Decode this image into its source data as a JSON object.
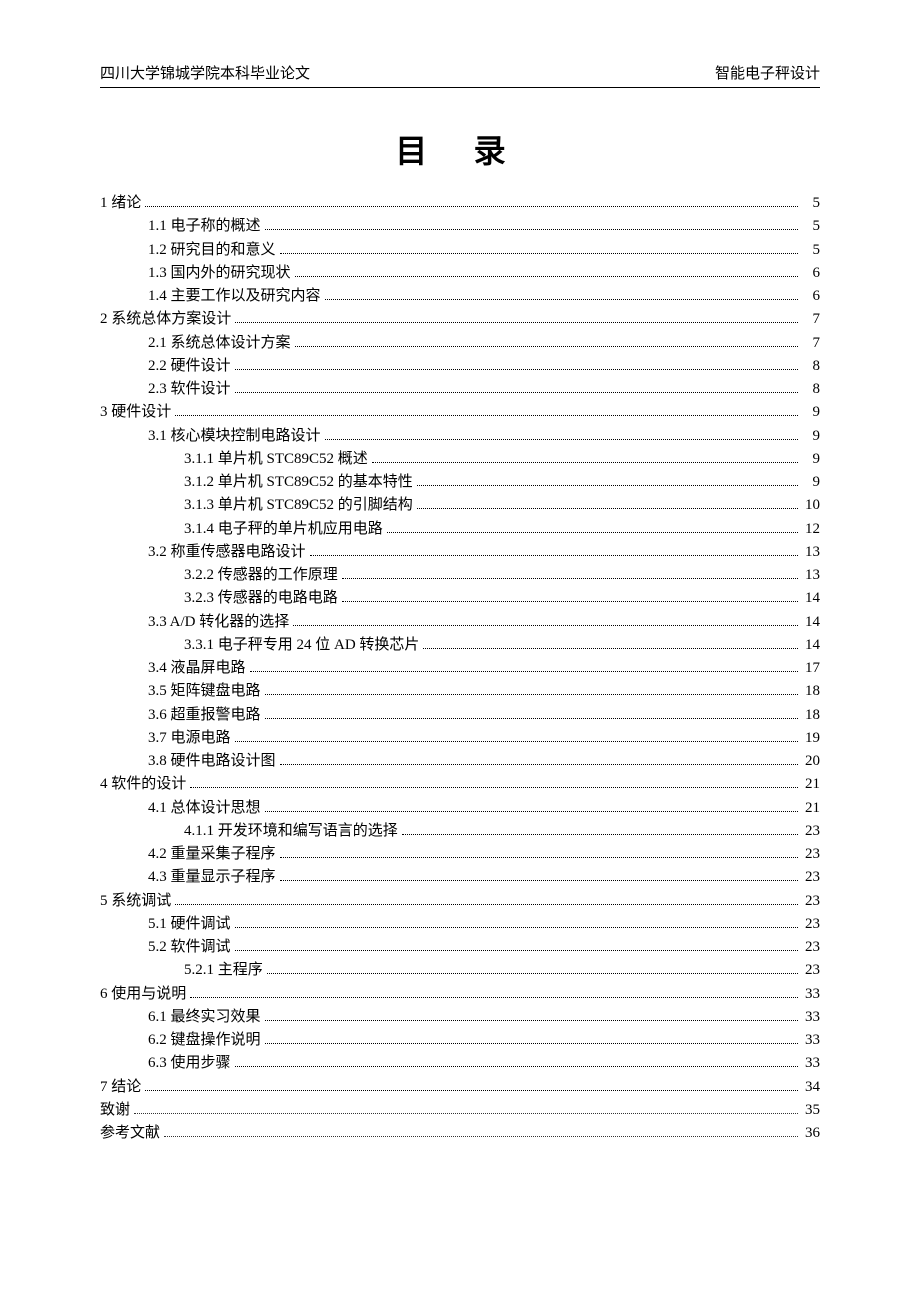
{
  "header": {
    "left": "四川大学锦城学院本科毕业论文",
    "right": "智能电子秤设计"
  },
  "title": "目 录",
  "toc": [
    {
      "level": 0,
      "label": "1 绪论",
      "page": "5"
    },
    {
      "level": 1,
      "label": "1.1 电子称的概述",
      "page": "5"
    },
    {
      "level": 1,
      "label": "1.2 研究目的和意义",
      "page": "5"
    },
    {
      "level": 1,
      "label": "1.3 国内外的研究现状",
      "page": "6"
    },
    {
      "level": 1,
      "label": "1.4 主要工作以及研究内容",
      "page": "6"
    },
    {
      "level": 0,
      "label": "2 系统总体方案设计",
      "page": "7"
    },
    {
      "level": 1,
      "label": "2.1 系统总体设计方案",
      "page": "7"
    },
    {
      "level": 1,
      "label": "2.2 硬件设计",
      "page": "8"
    },
    {
      "level": 1,
      "label": "2.3 软件设计",
      "page": "8"
    },
    {
      "level": 0,
      "label": "3 硬件设计",
      "page": "9"
    },
    {
      "level": 1,
      "label": "3.1 核心模块控制电路设计",
      "page": "9"
    },
    {
      "level": 2,
      "label": "3.1.1 单片机 STC89C52 概述",
      "page": "9"
    },
    {
      "level": 2,
      "label": "3.1.2 单片机 STC89C52 的基本特性",
      "page": "9"
    },
    {
      "level": 2,
      "label": "3.1.3 单片机 STC89C52 的引脚结构",
      "page": "10"
    },
    {
      "level": 2,
      "label": "3.1.4 电子秤的单片机应用电路",
      "page": "12"
    },
    {
      "level": 1,
      "label": "3.2 称重传感器电路设计",
      "page": "13"
    },
    {
      "level": 2,
      "label": "3.2.2 传感器的工作原理",
      "page": "13"
    },
    {
      "level": 2,
      "label": "3.2.3 传感器的电路电路",
      "page": "14"
    },
    {
      "level": 1,
      "label": "3.3 A/D 转化器的选择",
      "page": "14"
    },
    {
      "level": 2,
      "label": "3.3.1 电子秤专用 24 位 AD 转换芯片",
      "page": "14"
    },
    {
      "level": 1,
      "label": "3.4 液晶屏电路",
      "page": "17"
    },
    {
      "level": 1,
      "label": "3.5 矩阵键盘电路",
      "page": "18"
    },
    {
      "level": 1,
      "label": "3.6 超重报警电路",
      "page": "18"
    },
    {
      "level": 1,
      "label": "3.7 电源电路",
      "page": "19"
    },
    {
      "level": 1,
      "label": "3.8 硬件电路设计图",
      "page": "20"
    },
    {
      "level": 0,
      "label": "4 软件的设计",
      "page": "21"
    },
    {
      "level": 1,
      "label": "4.1 总体设计思想",
      "page": "21"
    },
    {
      "level": 2,
      "label": "4.1.1 开发环境和编写语言的选择",
      "page": "23"
    },
    {
      "level": 1,
      "label": "4.2 重量采集子程序",
      "page": "23"
    },
    {
      "level": 1,
      "label": "4.3 重量显示子程序",
      "page": "23"
    },
    {
      "level": 0,
      "label": "5 系统调试",
      "page": "23"
    },
    {
      "level": 1,
      "label": "5.1 硬件调试",
      "page": "23"
    },
    {
      "level": 1,
      "label": "5.2 软件调试",
      "page": "23"
    },
    {
      "level": 2,
      "label": "5.2.1 主程序",
      "page": "23"
    },
    {
      "level": 0,
      "label": "6 使用与说明",
      "page": "33"
    },
    {
      "level": 1,
      "label": "6.1 最终实习效果",
      "page": "33"
    },
    {
      "level": 1,
      "label": "6.2 键盘操作说明",
      "page": "33"
    },
    {
      "level": 1,
      "label": "6.3 使用步骤",
      "page": "33"
    },
    {
      "level": 0,
      "label": "7 结论",
      "page": "34"
    },
    {
      "level": 0,
      "label": "致谢",
      "page": "35",
      "fine": true
    },
    {
      "level": 0,
      "label": "参考文献",
      "page": "36",
      "fine": true
    }
  ]
}
